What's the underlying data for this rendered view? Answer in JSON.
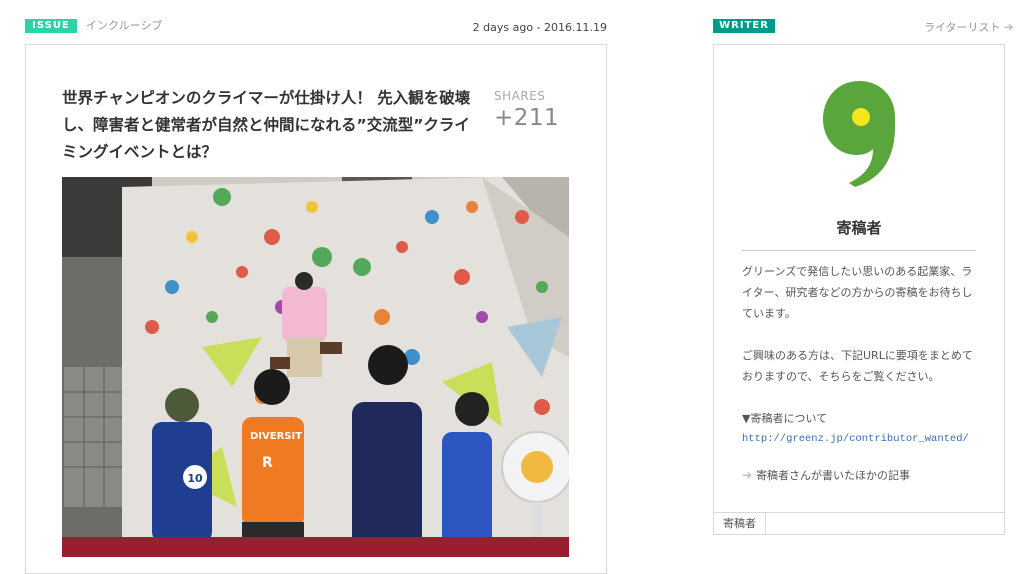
{
  "issue": {
    "badge": "ISSUE",
    "category": "インクルーシブ",
    "date": "2 days ago - 2016.11.19"
  },
  "article": {
    "title": "世界チャンピオンのクライマーが仕掛け人！ 先入観を破壊し、障害者と健常者が自然と仲間になれる”交流型”クライミングイベントとは？",
    "shares_label": "SHARES",
    "shares_count": "+211",
    "photo": {
      "shirt_text_1": "DIVERSIT",
      "shirt_text_2": "R",
      "shirt_number": "10"
    }
  },
  "writer": {
    "badge": "WRITER",
    "list_link": "ライターリスト",
    "name": "寄稿者",
    "description_1": "グリーンズで発信したい思いのある起業家、ライター、研究者などの方からの寄稿をお待ちしています。",
    "description_2": "ご興味のある方は、下記URLに要項をまとめておりますので、そちらをご覧ください。",
    "section_head": "▼寄稿者について",
    "contributor_url": "http://greenz.jp/contributor_wanted/",
    "other_articles": "寄稿者さんが書いたほかの記事",
    "footer_tag": "寄稿者",
    "logo_color": "#5aa63c",
    "logo_dot_color": "#f4e51d"
  },
  "colors": {
    "issue_badge": "#2bd4a8",
    "writer_badge": "#009a8b"
  }
}
